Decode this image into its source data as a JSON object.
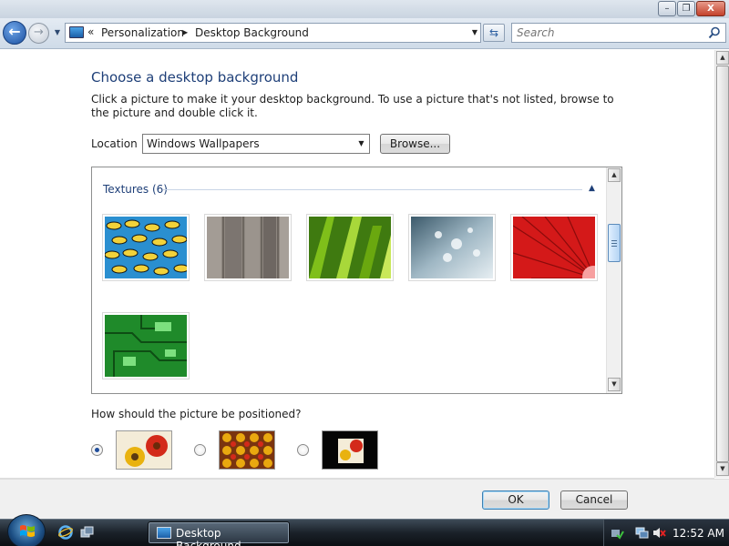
{
  "window": {
    "minimize": "–",
    "restore": "❐",
    "close": "X"
  },
  "nav": {
    "back_icon": "arrow-left-icon",
    "forward_icon": "arrow-right-icon",
    "history_icon": "chevron-down-icon",
    "address_overflow": "«",
    "breadcrumbs": [
      "Personalization",
      "Desktop Background"
    ],
    "refresh_icon": "refresh-icon",
    "search_placeholder": "Search"
  },
  "main": {
    "title": "Choose a desktop background",
    "description": "Click a picture to make it your desktop background. To use a picture that's not listed, browse to the picture and double click it.",
    "location_label": "Location",
    "location_value": "Windows Wallpapers",
    "browse_label": "Browse...",
    "group_header": "Textures (6)",
    "thumbnails": [
      {
        "name": "fish",
        "colors": [
          "#2a8fd0",
          "#f2d23a",
          "#111"
        ]
      },
      {
        "name": "wood",
        "colors": [
          "#7c7570",
          "#a39c95",
          "#5e5751"
        ]
      },
      {
        "name": "leaves",
        "colors": [
          "#7fbf1a",
          "#3f7a10",
          "#c9e85a"
        ]
      },
      {
        "name": "droplets",
        "colors": [
          "#9fb7c4",
          "#e6eef2",
          "#3c5a6b"
        ]
      },
      {
        "name": "red-flower",
        "colors": [
          "#d41919",
          "#8a0b0b",
          "#f7a0a0"
        ]
      },
      {
        "name": "circuit",
        "colors": [
          "#1f8a2a",
          "#0e4d14",
          "#7de07f"
        ]
      }
    ],
    "position_question": "How should the picture be positioned?",
    "position_options": [
      {
        "name": "fit-to-screen",
        "selected": true
      },
      {
        "name": "tile",
        "selected": false
      },
      {
        "name": "center",
        "selected": false
      }
    ]
  },
  "footer": {
    "ok_label": "OK",
    "cancel_label": "Cancel"
  },
  "taskbar": {
    "task_title": "Desktop Background",
    "clock": "12:52 AM"
  },
  "colors": {
    "title_blue": "#1e3f78",
    "selected_radio": "#1f4d9a"
  }
}
